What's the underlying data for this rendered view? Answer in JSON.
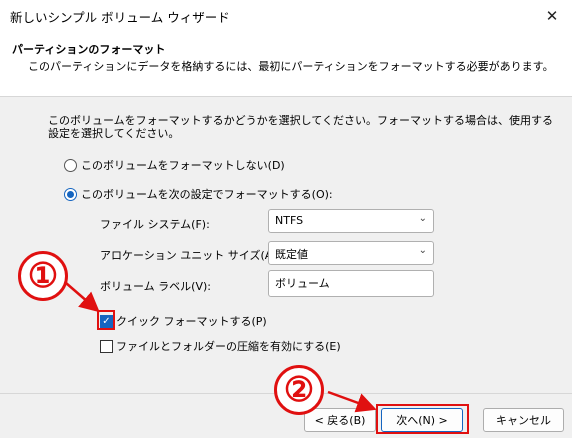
{
  "window": {
    "title": "新しいシンプル ボリューム ウィザード",
    "close_glyph": "✕"
  },
  "header": {
    "title": "パーティションのフォーマット",
    "subtitle": "このパーティションにデータを格納するには、最初にパーティションをフォーマットする必要があります。"
  },
  "body": {
    "description": "このボリュームをフォーマットするかどうかを選択してください。フォーマットする場合は、使用する設定を選択してください。",
    "radio_no_format": "このボリュームをフォーマットしない(D)",
    "radio_format": "このボリュームを次の設定でフォーマットする(O):",
    "fs_label": "ファイル システム(F):",
    "fs_value": "NTFS",
    "alloc_label": "アロケーション ユニット サイズ(A):",
    "alloc_value": "既定値",
    "volume_label": "ボリューム ラベル(V):",
    "volume_value": "ボリューム",
    "quick_format": "クイック フォーマットする(P)",
    "compression": "ファイルとフォルダーの圧縮を有効にする(E)"
  },
  "buttons": {
    "back": "< 戻る(B)",
    "next": "次へ(N) >",
    "cancel": "キャンセル"
  },
  "annotations": {
    "one": "①",
    "two": "②"
  }
}
